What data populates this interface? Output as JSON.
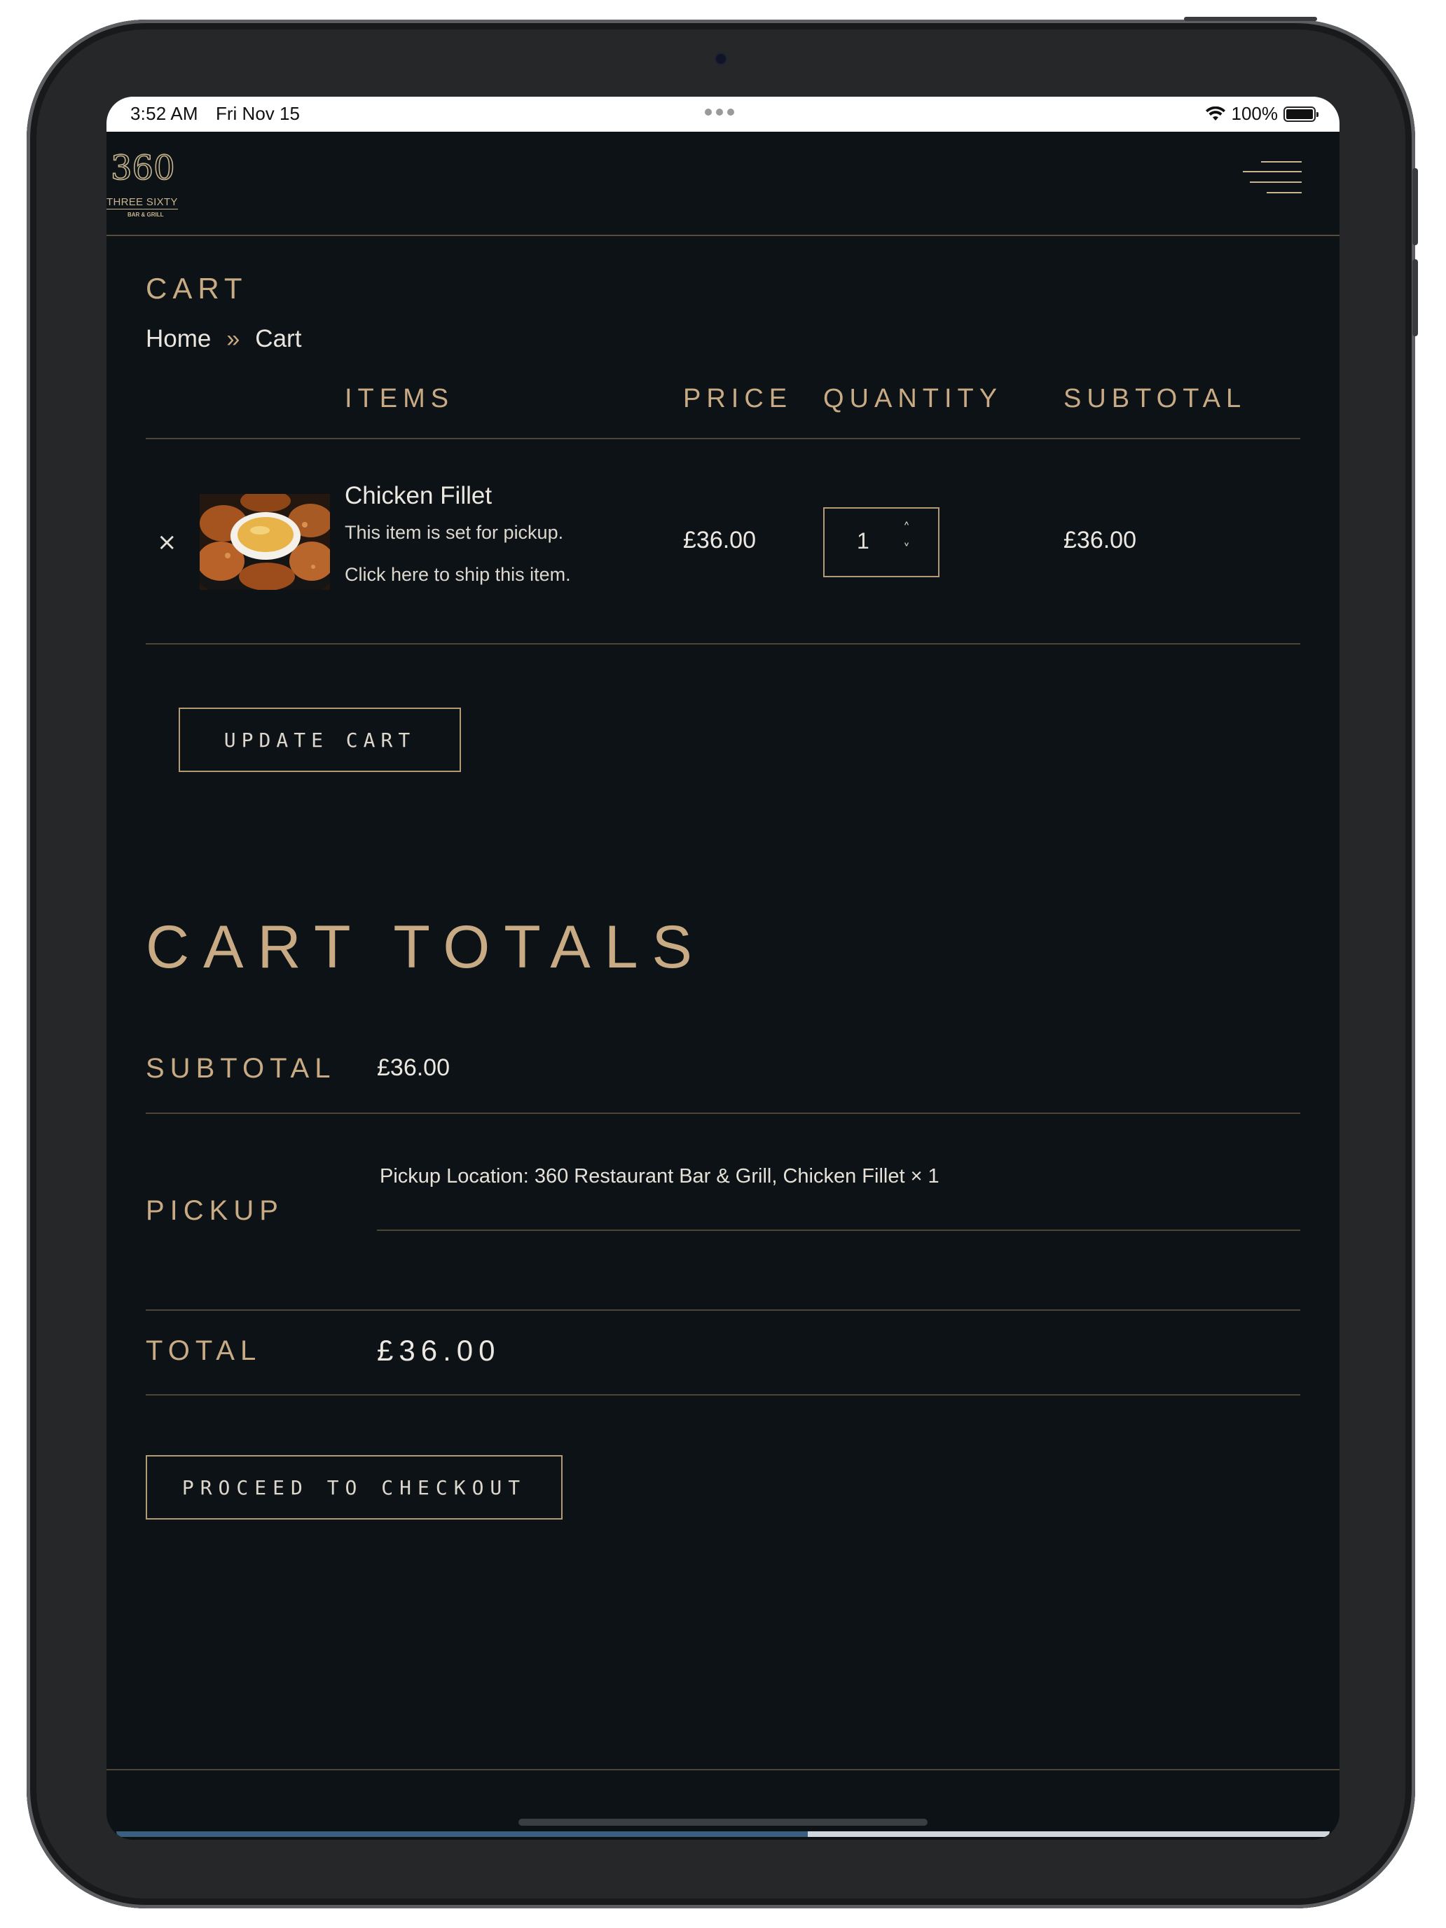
{
  "status_bar": {
    "time": "3:52 AM",
    "date": "Fri Nov 15",
    "battery": "100%"
  },
  "header": {
    "logo_mark": "360",
    "logo_name": "THREE SIXTY",
    "logo_sub": "BAR & GRILL"
  },
  "page": {
    "title": "CART",
    "breadcrumb": [
      "Home",
      "»",
      "Cart"
    ]
  },
  "cart_table": {
    "headers": {
      "items": "ITEMS",
      "price": "PRICE",
      "quantity": "QUANTITY",
      "subtotal": "SUBTOTAL"
    },
    "rows": [
      {
        "remove": "×",
        "name": "Chicken Fillet",
        "note_pickup": "This item is set for pickup.",
        "note_ship": "Click here to ship this item.",
        "price": "£36.00",
        "quantity": "1",
        "subtotal": "£36.00"
      }
    ]
  },
  "update_cart_label": "UPDATE CART",
  "totals": {
    "title": "CART TOTALS",
    "subtotal_label": "SUBTOTAL",
    "subtotal_value": "£36.00",
    "pickup_label": "PICKUP",
    "pickup_text": "Pickup Location: 360 Restaurant Bar & Grill,  Chicken Fillet × 1",
    "total_label": "TOTAL",
    "total_value": "£36.00"
  },
  "checkout_label": "PROCEED TO CHECKOUT",
  "colors": {
    "background": "#0c1215",
    "accent_gold": "#c8ab84",
    "rule": "#4f4535"
  },
  "icons": [
    "wifi-icon",
    "battery-icon",
    "hamburger-menu-icon",
    "remove-icon",
    "chevron-up-icon",
    "chevron-down-icon"
  ]
}
